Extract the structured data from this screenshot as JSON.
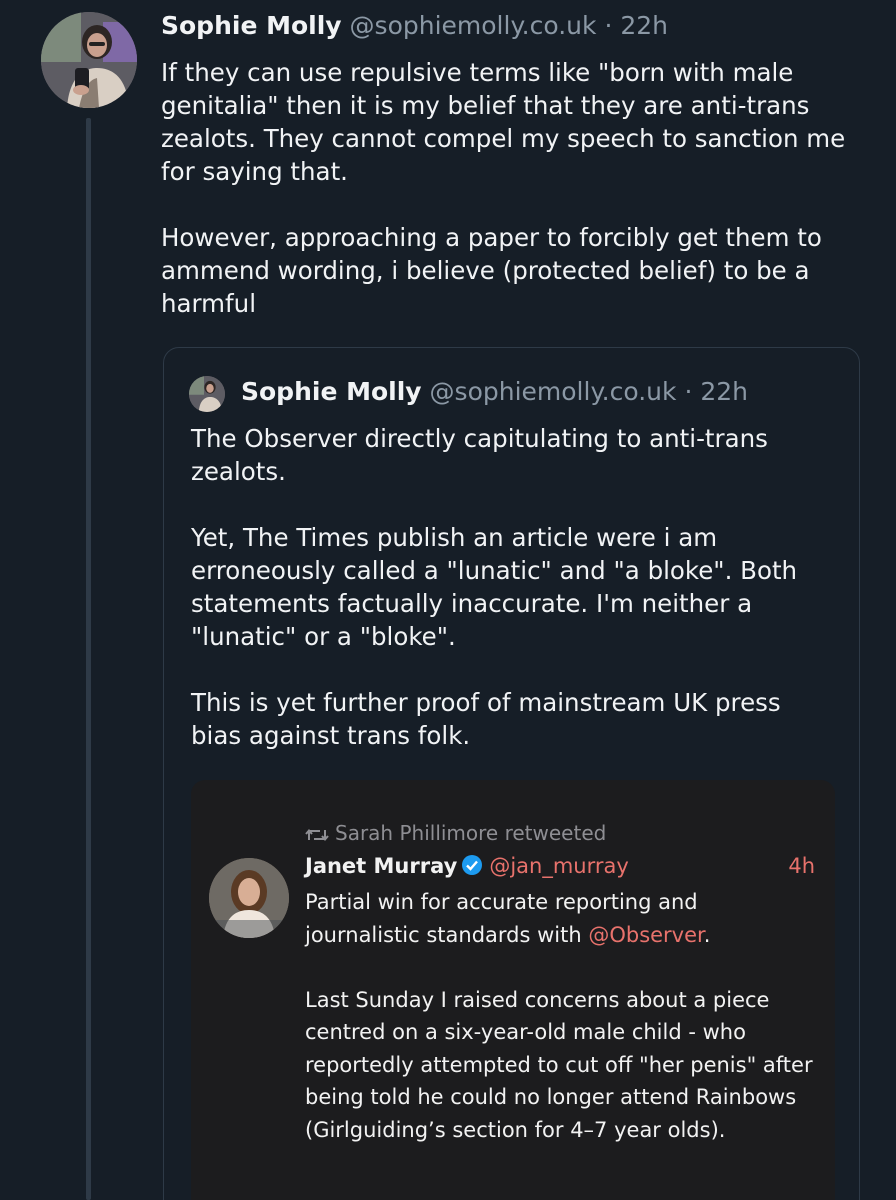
{
  "post": {
    "author_name": "Sophie Molly",
    "handle": "@sophiemolly.co.uk",
    "time": "22h",
    "paragraphs": [
      "If they can use repulsive terms like \"born with male genitalia\" then it is my belief that they are anti-trans zealots. They cannot compel my speech to sanction me for saying that.",
      "However, approaching a paper to forcibly get them to ammend wording, i believe (protected belief) to be a harmful"
    ]
  },
  "quote": {
    "author_name": "Sophie Molly",
    "handle": "@sophiemolly.co.uk",
    "time": "22h",
    "paragraphs": [
      "The Observer directly capitulating to anti-trans zealots.",
      "Yet, The Times publish an article were i am erroneously called a \"lunatic\" and \"a bloke\". Both statements factually inaccurate. I'm neither a \"lunatic\" or a \"bloke\".",
      "This is yet further proof of mainstream UK press bias against trans folk."
    ]
  },
  "embedded_screenshot": {
    "retweeted_by": "Sarah Phillimore retweeted",
    "author_name": "Janet Murray",
    "handle": "@jan_murray",
    "time": "4h",
    "para1_text": "Partial win for accurate reporting and journalistic standards with ",
    "para1_mention": "@Observer",
    "para1_end": ".",
    "para2": "Last Sunday I raised concerns about a piece centred on a six-year-old male child - who reportedly attempted to cut off \"her penis\" after being told he could no longer attend Rainbows (Girlguiding’s section for 4–7 year olds)."
  },
  "icons": {
    "retweet": "retweet-icon",
    "verified": "verified-badge-icon"
  },
  "colors": {
    "background": "#161e27",
    "muted_text": "#8b98a5",
    "embed_background": "#1c1c1e",
    "embed_accent": "#e8726c",
    "verified_blue": "#1d9bf0"
  }
}
